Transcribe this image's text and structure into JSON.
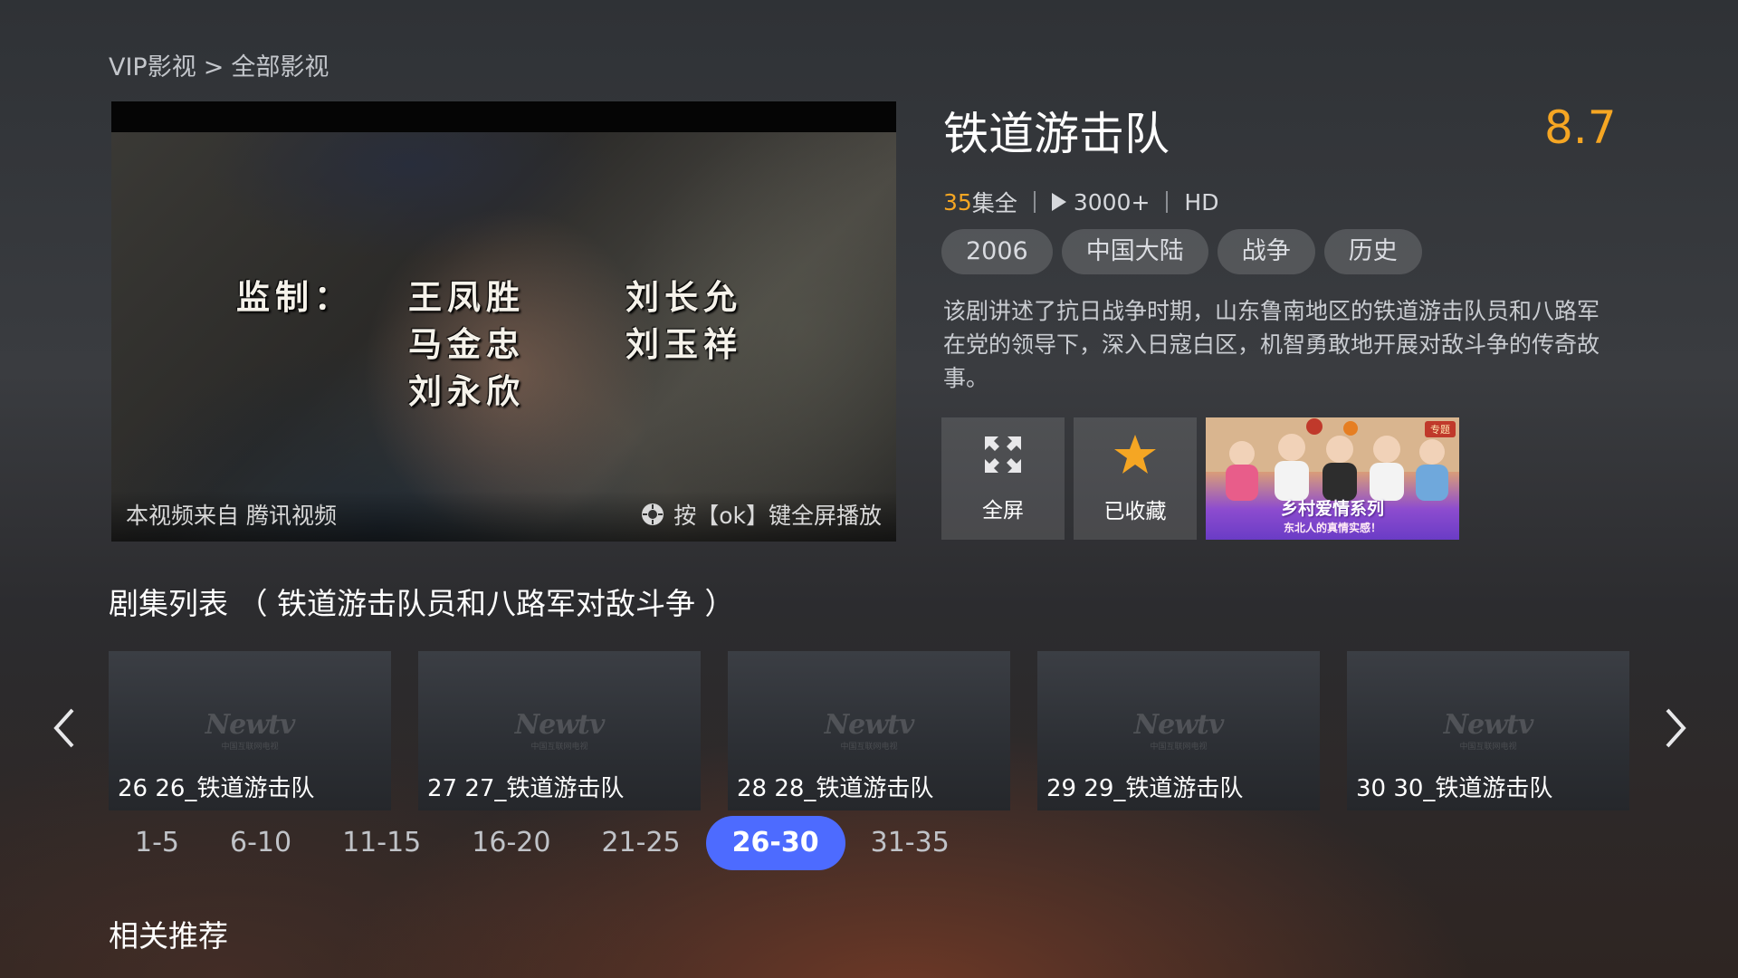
{
  "breadcrumb": {
    "parent": "VIP影视",
    "separator": ">",
    "current": "全部影视"
  },
  "player": {
    "credits": [
      {
        "label": "监制：",
        "names": [
          "王凤胜",
          "刘长允"
        ]
      },
      {
        "label": "",
        "names": [
          "马金忠",
          "刘玉祥"
        ]
      },
      {
        "label": "",
        "names": [
          "刘永欣",
          ""
        ]
      }
    ],
    "source_text": "本视频来自 腾讯视频",
    "ok_hint": "按【ok】键全屏播放"
  },
  "show": {
    "title": "铁道游击队",
    "score": "8.7",
    "episode_count": "35",
    "episode_suffix": "集全",
    "plays": "3000+",
    "quality": "HD",
    "tags": [
      "2006",
      "中国大陆",
      "战争",
      "历史"
    ],
    "description": "该剧讲述了抗日战争时期，山东鲁南地区的铁道游击队员和八路军在党的领导下，深入日寇白区，机智勇敢地开展对敌斗争的传奇故事。"
  },
  "actions": {
    "fullscreen_label": "全屏",
    "favorite_label": "已收藏",
    "promo": {
      "title": "乡村爱情系列",
      "subtitle": "东北人的真情实感！",
      "badge": "专题"
    }
  },
  "episode_list": {
    "title": "剧集列表 （ 铁道游击队员和八路军对敌斗争 ）",
    "watermark": "Newtv",
    "watermark_sub": "中国互联网电视",
    "episodes": [
      {
        "label": "26 26_铁道游击队"
      },
      {
        "label": "27 27_铁道游击队"
      },
      {
        "label": "28 28_铁道游击队"
      },
      {
        "label": "29 29_铁道游击队"
      },
      {
        "label": "30 30_铁道游击队"
      }
    ],
    "ranges": [
      "1-5",
      "6-10",
      "11-15",
      "16-20",
      "21-25",
      "26-30",
      "31-35"
    ],
    "active_range": "26-30"
  },
  "related": {
    "title": "相关推荐"
  },
  "colors": {
    "accent": "#4d6bff",
    "score": "#f5a623"
  }
}
